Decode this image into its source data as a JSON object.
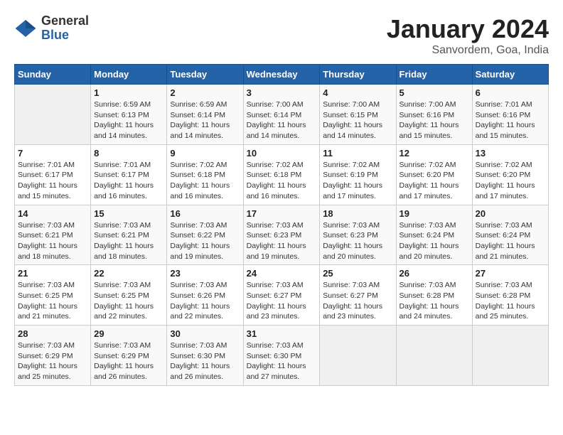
{
  "header": {
    "logo_general": "General",
    "logo_blue": "Blue",
    "title": "January 2024",
    "location": "Sanvordem, Goa, India"
  },
  "weekdays": [
    "Sunday",
    "Monday",
    "Tuesday",
    "Wednesday",
    "Thursday",
    "Friday",
    "Saturday"
  ],
  "weeks": [
    [
      {
        "day": "",
        "sunrise": "",
        "sunset": "",
        "daylight": ""
      },
      {
        "day": "1",
        "sunrise": "Sunrise: 6:59 AM",
        "sunset": "Sunset: 6:13 PM",
        "daylight": "Daylight: 11 hours and 14 minutes."
      },
      {
        "day": "2",
        "sunrise": "Sunrise: 6:59 AM",
        "sunset": "Sunset: 6:14 PM",
        "daylight": "Daylight: 11 hours and 14 minutes."
      },
      {
        "day": "3",
        "sunrise": "Sunrise: 7:00 AM",
        "sunset": "Sunset: 6:14 PM",
        "daylight": "Daylight: 11 hours and 14 minutes."
      },
      {
        "day": "4",
        "sunrise": "Sunrise: 7:00 AM",
        "sunset": "Sunset: 6:15 PM",
        "daylight": "Daylight: 11 hours and 14 minutes."
      },
      {
        "day": "5",
        "sunrise": "Sunrise: 7:00 AM",
        "sunset": "Sunset: 6:16 PM",
        "daylight": "Daylight: 11 hours and 15 minutes."
      },
      {
        "day": "6",
        "sunrise": "Sunrise: 7:01 AM",
        "sunset": "Sunset: 6:16 PM",
        "daylight": "Daylight: 11 hours and 15 minutes."
      }
    ],
    [
      {
        "day": "7",
        "sunrise": "Sunrise: 7:01 AM",
        "sunset": "Sunset: 6:17 PM",
        "daylight": "Daylight: 11 hours and 15 minutes."
      },
      {
        "day": "8",
        "sunrise": "Sunrise: 7:01 AM",
        "sunset": "Sunset: 6:17 PM",
        "daylight": "Daylight: 11 hours and 16 minutes."
      },
      {
        "day": "9",
        "sunrise": "Sunrise: 7:02 AM",
        "sunset": "Sunset: 6:18 PM",
        "daylight": "Daylight: 11 hours and 16 minutes."
      },
      {
        "day": "10",
        "sunrise": "Sunrise: 7:02 AM",
        "sunset": "Sunset: 6:18 PM",
        "daylight": "Daylight: 11 hours and 16 minutes."
      },
      {
        "day": "11",
        "sunrise": "Sunrise: 7:02 AM",
        "sunset": "Sunset: 6:19 PM",
        "daylight": "Daylight: 11 hours and 17 minutes."
      },
      {
        "day": "12",
        "sunrise": "Sunrise: 7:02 AM",
        "sunset": "Sunset: 6:20 PM",
        "daylight": "Daylight: 11 hours and 17 minutes."
      },
      {
        "day": "13",
        "sunrise": "Sunrise: 7:02 AM",
        "sunset": "Sunset: 6:20 PM",
        "daylight": "Daylight: 11 hours and 17 minutes."
      }
    ],
    [
      {
        "day": "14",
        "sunrise": "Sunrise: 7:03 AM",
        "sunset": "Sunset: 6:21 PM",
        "daylight": "Daylight: 11 hours and 18 minutes."
      },
      {
        "day": "15",
        "sunrise": "Sunrise: 7:03 AM",
        "sunset": "Sunset: 6:21 PM",
        "daylight": "Daylight: 11 hours and 18 minutes."
      },
      {
        "day": "16",
        "sunrise": "Sunrise: 7:03 AM",
        "sunset": "Sunset: 6:22 PM",
        "daylight": "Daylight: 11 hours and 19 minutes."
      },
      {
        "day": "17",
        "sunrise": "Sunrise: 7:03 AM",
        "sunset": "Sunset: 6:23 PM",
        "daylight": "Daylight: 11 hours and 19 minutes."
      },
      {
        "day": "18",
        "sunrise": "Sunrise: 7:03 AM",
        "sunset": "Sunset: 6:23 PM",
        "daylight": "Daylight: 11 hours and 20 minutes."
      },
      {
        "day": "19",
        "sunrise": "Sunrise: 7:03 AM",
        "sunset": "Sunset: 6:24 PM",
        "daylight": "Daylight: 11 hours and 20 minutes."
      },
      {
        "day": "20",
        "sunrise": "Sunrise: 7:03 AM",
        "sunset": "Sunset: 6:24 PM",
        "daylight": "Daylight: 11 hours and 21 minutes."
      }
    ],
    [
      {
        "day": "21",
        "sunrise": "Sunrise: 7:03 AM",
        "sunset": "Sunset: 6:25 PM",
        "daylight": "Daylight: 11 hours and 21 minutes."
      },
      {
        "day": "22",
        "sunrise": "Sunrise: 7:03 AM",
        "sunset": "Sunset: 6:25 PM",
        "daylight": "Daylight: 11 hours and 22 minutes."
      },
      {
        "day": "23",
        "sunrise": "Sunrise: 7:03 AM",
        "sunset": "Sunset: 6:26 PM",
        "daylight": "Daylight: 11 hours and 22 minutes."
      },
      {
        "day": "24",
        "sunrise": "Sunrise: 7:03 AM",
        "sunset": "Sunset: 6:27 PM",
        "daylight": "Daylight: 11 hours and 23 minutes."
      },
      {
        "day": "25",
        "sunrise": "Sunrise: 7:03 AM",
        "sunset": "Sunset: 6:27 PM",
        "daylight": "Daylight: 11 hours and 23 minutes."
      },
      {
        "day": "26",
        "sunrise": "Sunrise: 7:03 AM",
        "sunset": "Sunset: 6:28 PM",
        "daylight": "Daylight: 11 hours and 24 minutes."
      },
      {
        "day": "27",
        "sunrise": "Sunrise: 7:03 AM",
        "sunset": "Sunset: 6:28 PM",
        "daylight": "Daylight: 11 hours and 25 minutes."
      }
    ],
    [
      {
        "day": "28",
        "sunrise": "Sunrise: 7:03 AM",
        "sunset": "Sunset: 6:29 PM",
        "daylight": "Daylight: 11 hours and 25 minutes."
      },
      {
        "day": "29",
        "sunrise": "Sunrise: 7:03 AM",
        "sunset": "Sunset: 6:29 PM",
        "daylight": "Daylight: 11 hours and 26 minutes."
      },
      {
        "day": "30",
        "sunrise": "Sunrise: 7:03 AM",
        "sunset": "Sunset: 6:30 PM",
        "daylight": "Daylight: 11 hours and 26 minutes."
      },
      {
        "day": "31",
        "sunrise": "Sunrise: 7:03 AM",
        "sunset": "Sunset: 6:30 PM",
        "daylight": "Daylight: 11 hours and 27 minutes."
      },
      {
        "day": "",
        "sunrise": "",
        "sunset": "",
        "daylight": ""
      },
      {
        "day": "",
        "sunrise": "",
        "sunset": "",
        "daylight": ""
      },
      {
        "day": "",
        "sunrise": "",
        "sunset": "",
        "daylight": ""
      }
    ]
  ]
}
